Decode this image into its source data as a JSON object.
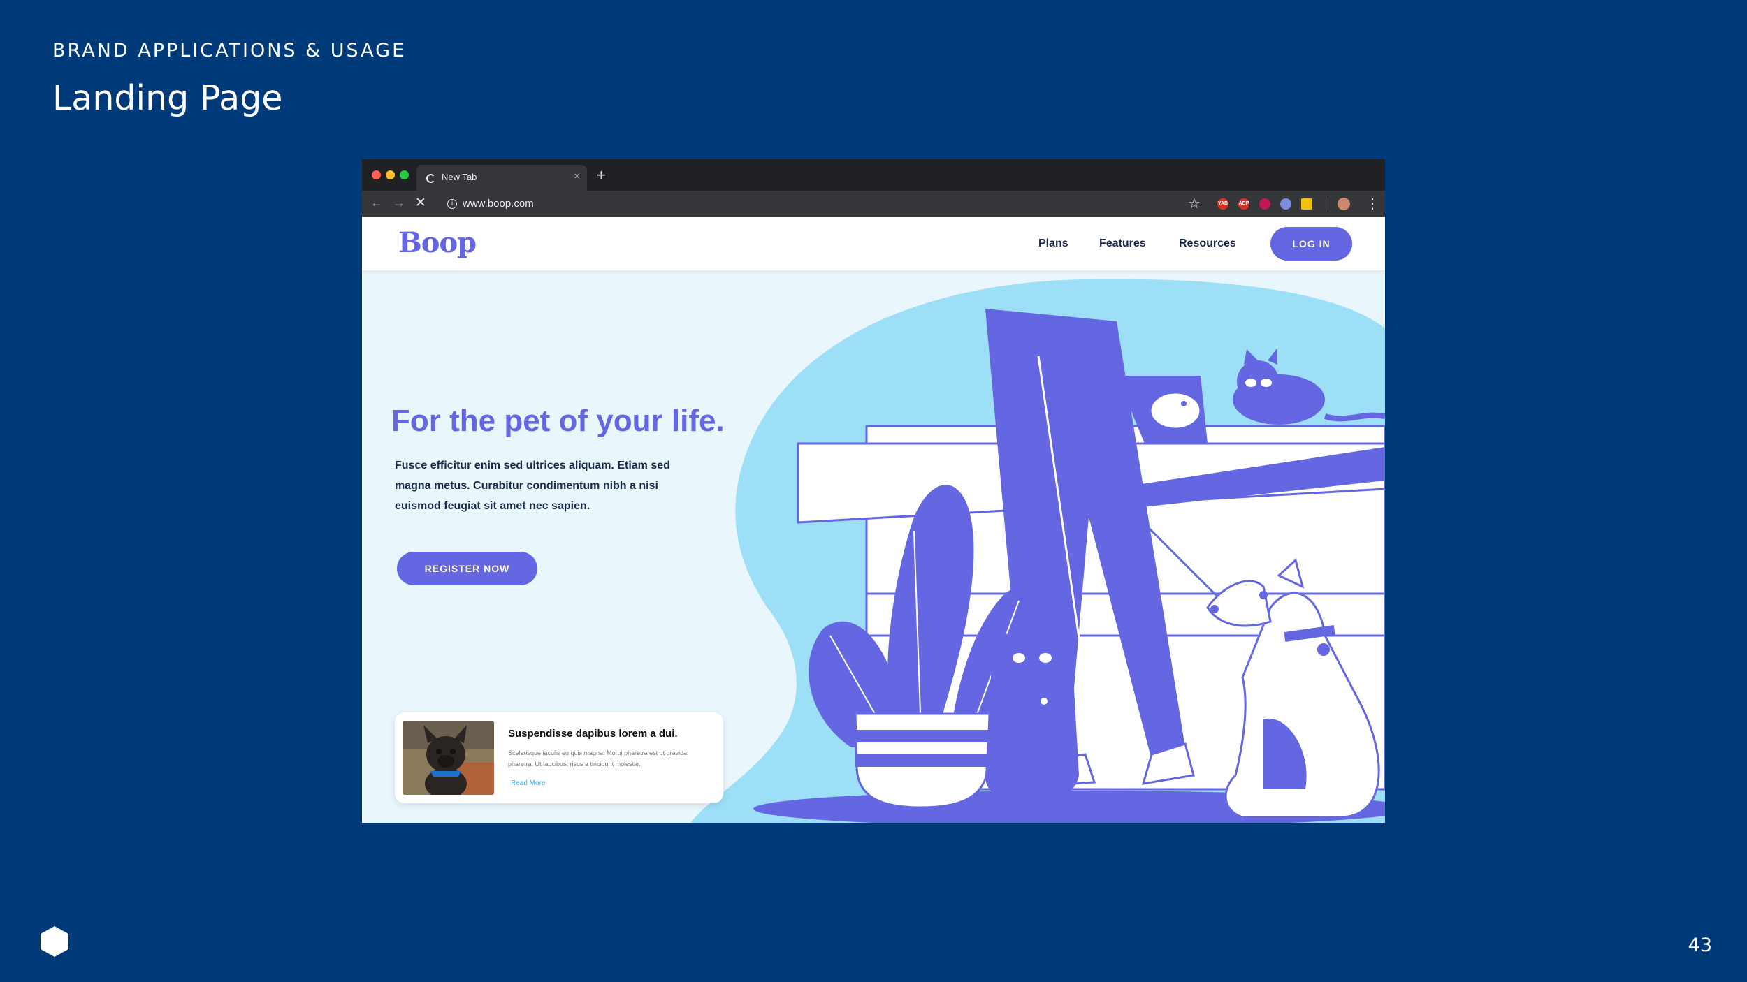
{
  "slide": {
    "eyebrow": "BRAND APPLICATIONS & USAGE",
    "title": "Landing Page",
    "page_number": "43"
  },
  "browser": {
    "tab_title": "New Tab",
    "tab_close": "×",
    "new_tab": "+",
    "url": "www.boop.com",
    "back": "←",
    "forward": "→",
    "stop": "✕",
    "info": "i",
    "star": "☆",
    "menu": "⋮",
    "extensions": [
      "YAB",
      "ABP",
      "",
      "",
      ""
    ]
  },
  "site": {
    "logo": "Boop",
    "nav": {
      "plans": "Plans",
      "features": "Features",
      "resources": "Resources",
      "login": "LOG IN"
    },
    "hero": {
      "headline": "For the pet of your life.",
      "body": "Fusce efficitur enim sed ultrices aliquam. Etiam sed magna metus. Curabitur condimentum nibh a nisi euismod feugiat sit amet nec sapien.",
      "cta": "REGISTER NOW"
    },
    "card": {
      "title": "Suspendisse dapibus lorem a dui.",
      "body": "Scelerisque iaculis eu quis magna. Morbi pharetra est ut gravida pharetra. Ut faucibus, risus a tincidunt molestie.",
      "link": "Read More"
    }
  },
  "colors": {
    "slide_bg": "#003a78",
    "brand_purple": "#6466e2",
    "hero_bg": "#e9f6fc",
    "blob_blue": "#9ddff7"
  }
}
